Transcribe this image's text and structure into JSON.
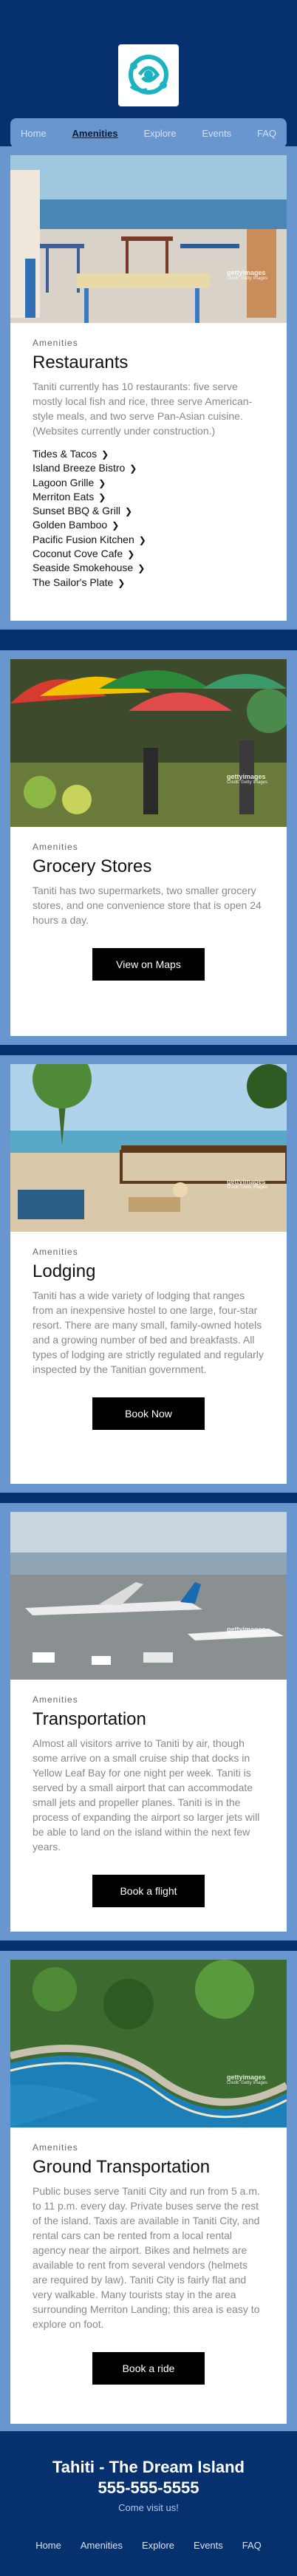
{
  "nav": {
    "items": [
      "Home",
      "Amenities",
      "Explore",
      "Events",
      "FAQ"
    ],
    "active": "Amenities"
  },
  "sections": [
    {
      "eyebrow": "Amenities",
      "title": "Restaurants",
      "desc": "Taniti currently has 10 restaurants: five serve mostly local fish and rice, three serve American-style meals, and two serve Pan-Asian cuisine. (Websites currently under construction.)",
      "restaurants": [
        "Tides & Tacos",
        "Island Breeze Bistro",
        "Lagoon Grille",
        "Merriton Eats",
        "Sunset BBQ & Grill",
        "Golden Bamboo",
        "Pacific Fusion Kitchen",
        "Coconut Cove Cafe",
        "Seaside Smokehouse",
        "The Sailor's Plate"
      ]
    },
    {
      "eyebrow": "Amenities",
      "title": "Grocery Stores",
      "desc": "Taniti has two supermarkets, two smaller grocery stores, and one convenience store that is open 24 hours a day.",
      "button": "View on Maps"
    },
    {
      "eyebrow": "Amenities",
      "title": "Lodging",
      "desc": "Taniti has a wide variety of lodging that ranges from an inexpensive hostel to one large, four-star resort. There are many small, family-owned hotels and a growing number of bed and breakfasts. All types of lodging are strictly regulated and regularly inspected by the Tanitian government.",
      "button": "Book Now"
    },
    {
      "eyebrow": "Amenities",
      "title": "Transportation",
      "desc": "Almost all visitors arrive to Taniti by air, though some arrive on a small cruise ship that docks in Yellow Leaf Bay for one night per week. Taniti is served by a small airport that can accommodate small jets and propeller planes. Taniti is in the process of expanding the airport so larger jets will be able to land on the island within the next few years.",
      "button": "Book a flight"
    },
    {
      "eyebrow": "Amenities",
      "title": "Ground Transportation",
      "desc": "Public buses serve Taniti City and run from 5 a.m. to 11 p.m. every day. Private buses serve the rest of the island. Taxis are available in Taniti City, and rental cars can be rented from a local rental agency near the airport. Bikes and helmets are available to rent from several vendors (helmets are required by law). Taniti City is fairly flat and very walkable. Many tourists stay in the area surrounding Merriton Landing; this area is easy to explore on foot.",
      "button": "Book a ride"
    }
  ],
  "footer": {
    "title": "Tahiti - The Dream Island",
    "phone": "555-555-5555",
    "tagline": "Come visit us!",
    "nav": [
      "Home",
      "Amenities",
      "Explore",
      "Events",
      "FAQ"
    ]
  },
  "photo_credit": {
    "brand": "gettyimages",
    "line2": "Credit: Getty Images"
  },
  "colors": {
    "page_bg": "#06306e",
    "nav_bg": "#6a96cf",
    "button_bg": "#000000"
  }
}
